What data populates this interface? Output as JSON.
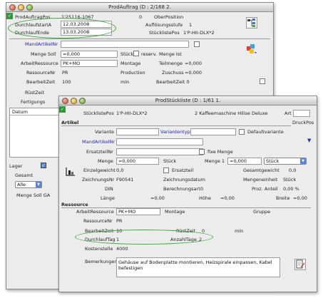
{
  "back": {
    "title": "ProdAuftrag (D : 2/168 2.",
    "fields": {
      "prodauftragpos_label": "ProdAuftragPos",
      "prodauftragpos_value": "1'25116-1067",
      "oberposition_num": "0",
      "oberposition_label": "OberPosition",
      "durchlaufstart_label": "DurchlaufstartA",
      "durchlaufstart_value": "12.03.2008",
      "aufloesungsstufe_label": "Auflösungsstufe",
      "aufloesungsstufe_value": "1",
      "durchlaufende_label": "DurchlaufEnde",
      "durchlaufende_value": "13.03.2008",
      "stuecklistepos_label": "StücklistePos",
      "stuecklistepos_value": "1'P-HII-DLX*2",
      "mandartikelnr_label": "MandArtikelNr",
      "menge_soll_label": "Menge Soll",
      "menge_soll_value": "=0,000",
      "stueck": "Stück",
      "reserv": "reserv.",
      "menge_ist_label": "Menge Ist",
      "arbeitressource_label": "ArbeitRessource",
      "arbeitressource_value": "PK+MO",
      "montage": "Montage",
      "teilmenge_label": "Teilmenge",
      "teilmenge_value": "=0,000",
      "ressourcenr_label": "RessourceNr",
      "ressourcenr_value": "PR",
      "production": "Production",
      "zuschuss_label": "Zuschuss",
      "zuschuss_value": "=0,000",
      "bearbeitzeit_label": "BearbeitZeit",
      "bearbeitzeit_value": "100",
      "min": "min",
      "bearbeitzeit_sel": "BearbeitZeit 0",
      "ruestzeit_label": "RüstZeit",
      "fertigungs_label": "Fertigungs",
      "datum_label": "Datum",
      "lager_label": "Lager",
      "gesamt_label": "Gesamt",
      "lager_select": "Alle",
      "menge_soll_bottom": "Menge Soll GA"
    }
  },
  "front": {
    "title": "ProdStückliste (D : 1/61 1.",
    "stuecklistepos_label": "StücklistePos",
    "stuecklistepos_value": "1'P-HII-DLX*2",
    "description": "2 Kaffeemaschine Hilise Deluxe",
    "art_label": "Art",
    "druckpos_label": "DruckPos",
    "section_artikel": "Artikel",
    "variante_label": "Variante",
    "variantentyp_label": "Variantentyp",
    "defaultvariante_label": "Defaultvariante",
    "mandartikelnr_label": "MandArtikelNr",
    "ersatzteilnr_label": "ErsatzteilNr",
    "fixe_menge_label": "fixe Menge",
    "menge_label": "Menge",
    "menge_value": "=0,000",
    "stueck_label": "Stück",
    "menge1_label": "Menge 1",
    "menge1_value": "=0,000",
    "menge1_unit": "Stück",
    "einzelgewicht_label": "Einzelgewicht",
    "einzelgewicht_value": "0,0",
    "ersatzteil_label": "Ersatzteil",
    "gesamtgewicht_label": "Gesamtgewicht",
    "gesamtgewicht_value": "0,0",
    "zeichnungsnr_label": "ZeichnungsNr",
    "zeichnungsnr_value": "F90541",
    "zeichnungsdatum_label": "Zeichnungsdatum",
    "mengeneinheit_label": "Mengeneinheit",
    "mengeneinheit_value": "Stück",
    "din_label": "DIN",
    "berechnungsart_label": "Berechnungsart",
    "berechnungsart_value": "0",
    "proz_anteil_label": "Proz. Anteil",
    "proz_anteil_value": "0,00 %",
    "laenge_label": "Länge",
    "laenge_value": "=0,00",
    "hoehe_label": "Höhe",
    "hoehe_value": "=0,00",
    "breite_label": "Breite",
    "breite_value": "=0,00",
    "section_ressource": "Ressource",
    "arbeitressource_label": "ArbeitRessource",
    "arbeitressource_value": "PK+MO",
    "montage_label": "Montage",
    "gruppe_label": "Gruppe",
    "ressourcenr_label": "RessourceNr",
    "ressourcenr_value": "PR",
    "bearbeitzeit_label": "BearbeitZeit",
    "bearbeitzeit_value": "10",
    "ruestzeit_label": "RüstZeit",
    "ruestzeit_value": "0",
    "min_label": "min",
    "durchlauftag_label": "DurchlaufTag",
    "durchlauftag_value": "1",
    "anzahltage_label": "AnzahlTage",
    "anzahltage_value": "2",
    "kostenstelle_label": "Kostenstelle",
    "kostenstelle_value": "4000",
    "bemerkungen_label": "Bemerkungen",
    "bemerkungen_value": "Gehäuse auf Bodenplatte montieren, Heizspirale einpassen, Kabel befestigen"
  },
  "colors": {
    "highlight": "#3ca83c",
    "link": "#2222cc"
  }
}
